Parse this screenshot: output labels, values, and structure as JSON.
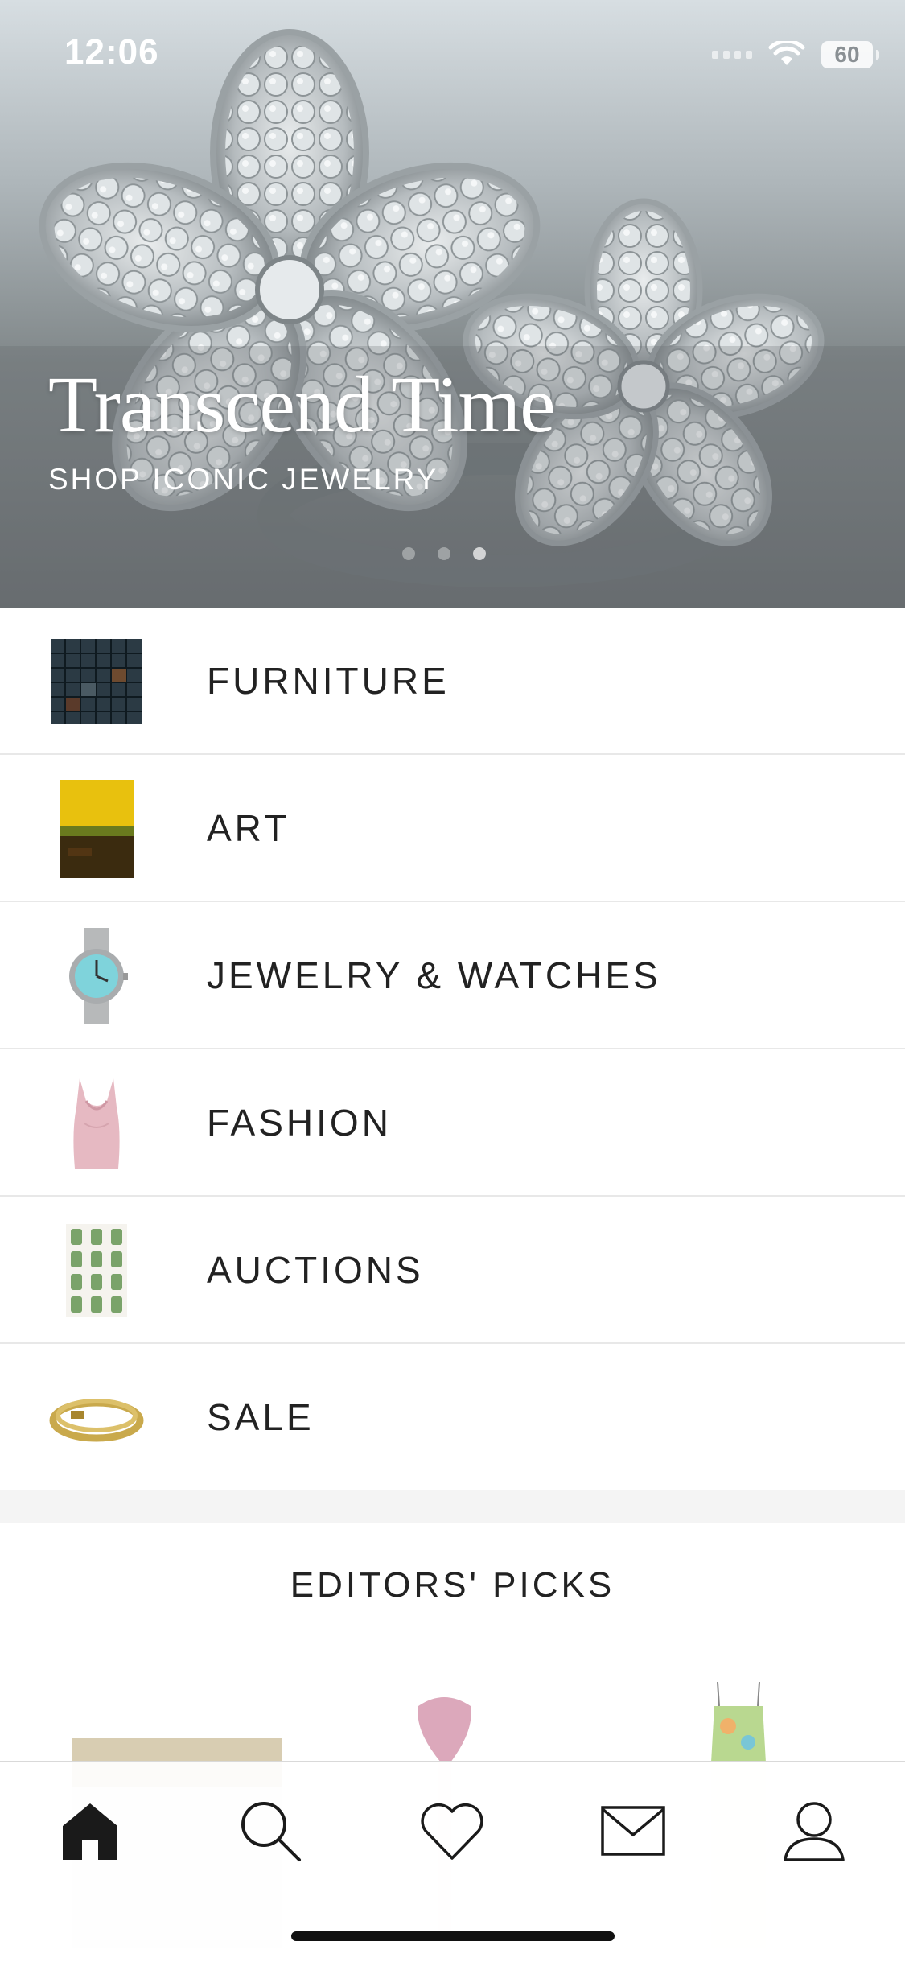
{
  "status_bar": {
    "time": "12:06",
    "battery": "60"
  },
  "hero": {
    "title": "Transcend Time",
    "subtitle": "SHOP ICONIC JEWELRY"
  },
  "categories": [
    {
      "label": "FURNITURE",
      "icon": "furniture-thumbnail"
    },
    {
      "label": "ART",
      "icon": "art-thumbnail"
    },
    {
      "label": "JEWELRY & WATCHES",
      "icon": "watch-thumbnail"
    },
    {
      "label": "FASHION",
      "icon": "fashion-thumbnail"
    },
    {
      "label": "AUCTIONS",
      "icon": "auctions-thumbnail"
    },
    {
      "label": "SALE",
      "icon": "ring-thumbnail"
    }
  ],
  "editors_picks": {
    "title": "EDITORS' PICKS"
  },
  "tab_bar": {
    "items": [
      {
        "icon": "home-icon"
      },
      {
        "icon": "search-icon"
      },
      {
        "icon": "heart-icon"
      },
      {
        "icon": "mail-icon"
      },
      {
        "icon": "profile-icon"
      }
    ]
  }
}
